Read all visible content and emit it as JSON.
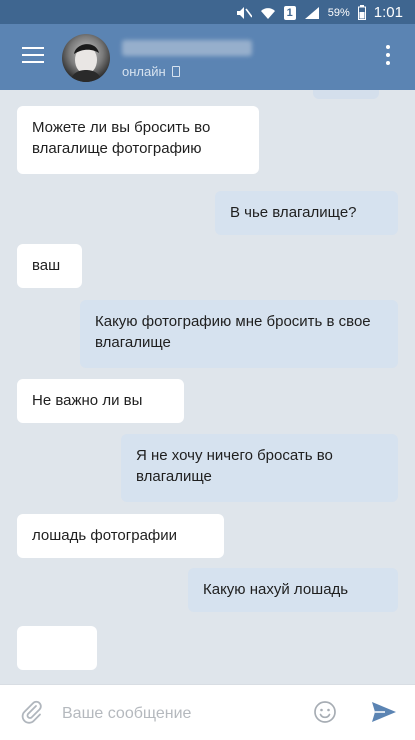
{
  "status_bar": {
    "battery_percent": "59%",
    "time": "1:01",
    "sim_badge": "1",
    "icons": [
      "mute-icon",
      "wifi-icon",
      "signal-icon",
      "battery-icon"
    ]
  },
  "header": {
    "status": "онлайн",
    "menu_icon": "hamburger-menu-icon",
    "more_icon": "overflow-menu-icon"
  },
  "messages": [
    {
      "direction": "in",
      "text": "Можете ли вы бросить во влагалище фотографию"
    },
    {
      "direction": "out",
      "text": "В чье влагалище?"
    },
    {
      "direction": "in",
      "text": "ваш"
    },
    {
      "direction": "out",
      "text": "Какую фотографию мне бросить в свое влагалище"
    },
    {
      "direction": "in",
      "text": "Не важно ли вы"
    },
    {
      "direction": "out",
      "text": "Я не хочу ничего бросать во влагалище"
    },
    {
      "direction": "in",
      "text": "лошадь фотографии"
    },
    {
      "direction": "out",
      "text": "Какую нахуй лошадь"
    },
    {
      "direction": "in",
      "text": ""
    }
  ],
  "composer": {
    "placeholder": "Ваше сообщение",
    "value": ""
  },
  "colors": {
    "status_bar": "#3f6690",
    "app_bar": "#5b84b3",
    "chat_background": "#dfe5eb",
    "incoming_bubble": "#ffffff",
    "outgoing_bubble": "#d6e2ef",
    "send_accent": "#5b84b3"
  }
}
